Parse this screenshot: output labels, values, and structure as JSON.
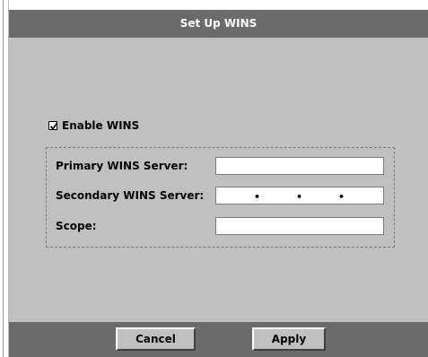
{
  "dialog": {
    "title": "Set Up WINS"
  },
  "enable": {
    "label": "Enable WINS",
    "checked": true
  },
  "fields": {
    "primary_label": "Primary WINS Server:",
    "primary_value": "",
    "secondary_label": "Secondary WINS Server:",
    "secondary_value": "",
    "scope_label": "Scope:",
    "scope_value": ""
  },
  "buttons": {
    "cancel_label": "Cancel",
    "apply_label": "Apply"
  },
  "icons": {
    "checkbox_mark": "check-icon"
  },
  "colors": {
    "title_bar": "#6b6b6b",
    "panel": "#c0c0c0",
    "title_text": "#ffffff"
  }
}
